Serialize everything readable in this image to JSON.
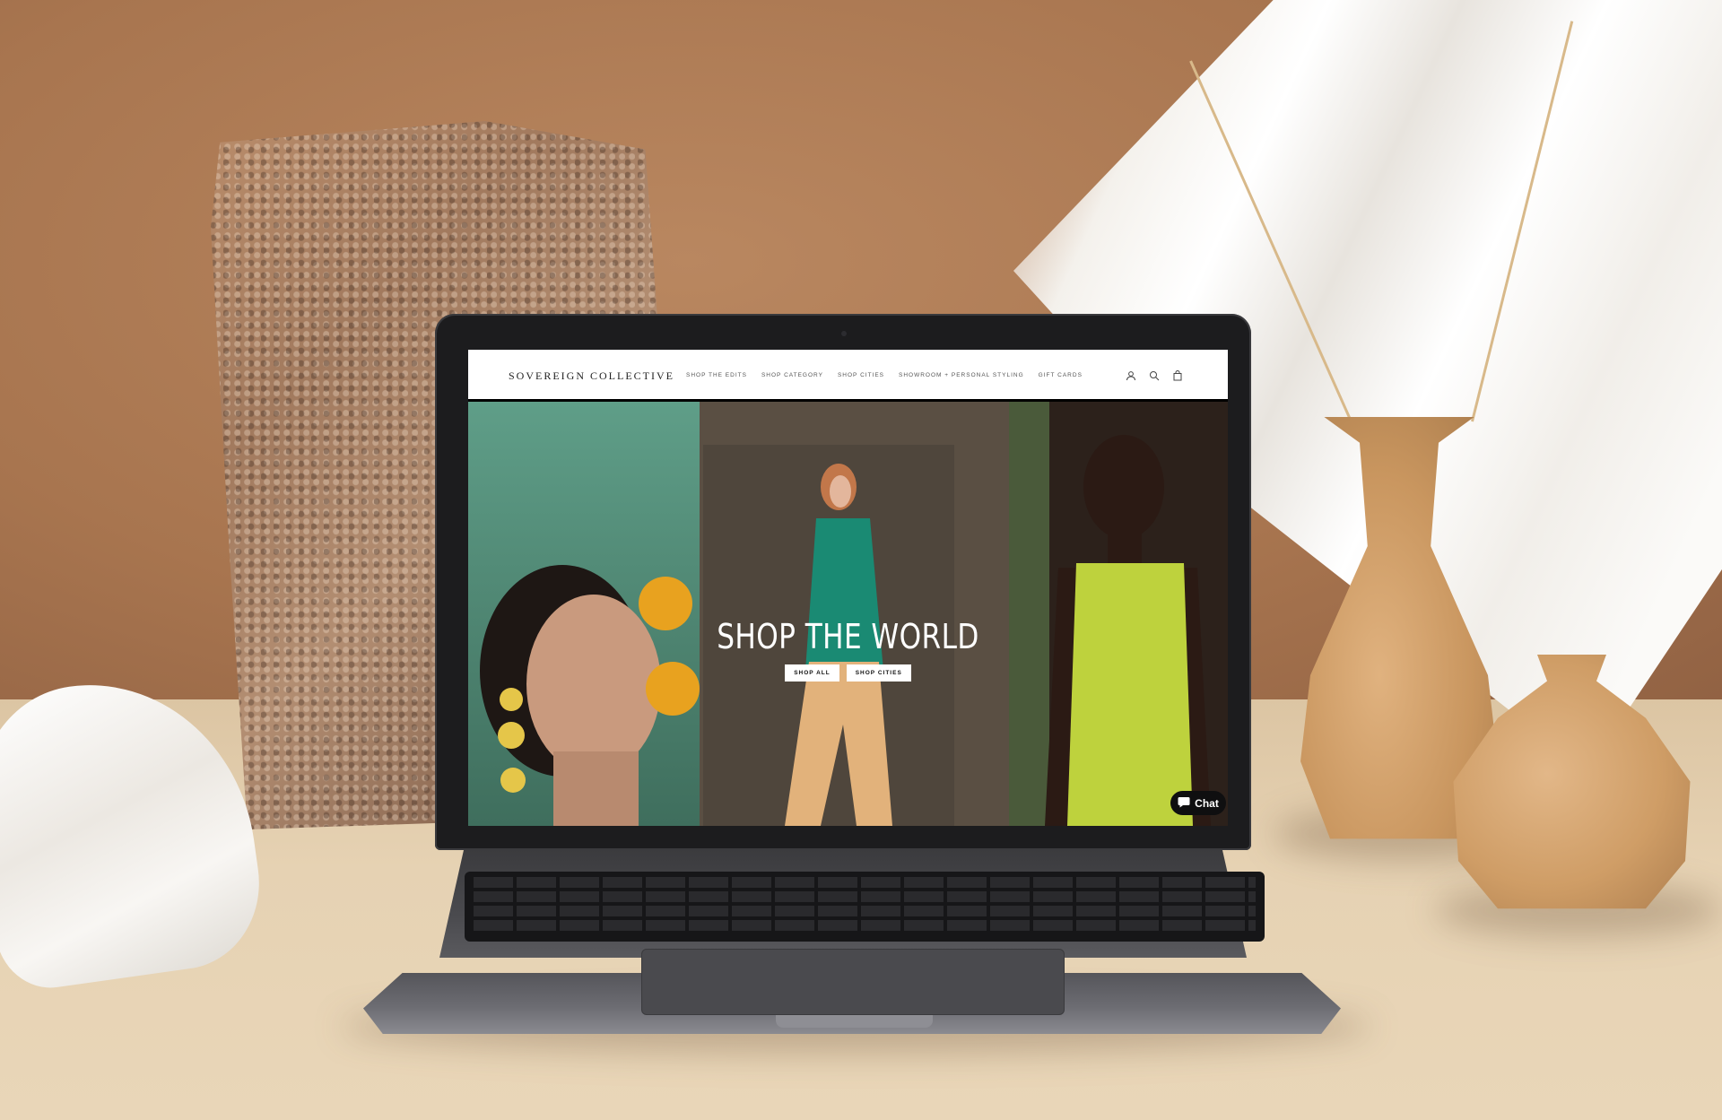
{
  "site": {
    "brand": "SOVEREIGN COLLECTIVE",
    "nav": [
      {
        "label": "SHOP THE EDITS"
      },
      {
        "label": "SHOP CATEGORY"
      },
      {
        "label": "SHOP CITIES"
      },
      {
        "label": "SHOWROOM + PERSONAL STYLING"
      },
      {
        "label": "GIFT CARDS"
      }
    ],
    "header_icons": [
      "account-icon",
      "search-icon",
      "cart-icon"
    ],
    "hero": {
      "title": "SHOP THE WORLD",
      "buttons": [
        {
          "label": "SHOP ALL"
        },
        {
          "label": "SHOP CITIES"
        }
      ]
    },
    "chat": {
      "label": "Chat",
      "icon": "chat-bubble-icon"
    }
  },
  "colors": {
    "wall": "#a8754f",
    "table": "#e6d2b3",
    "laptop": "#1c1c1e",
    "accent_white": "#ffffff"
  }
}
